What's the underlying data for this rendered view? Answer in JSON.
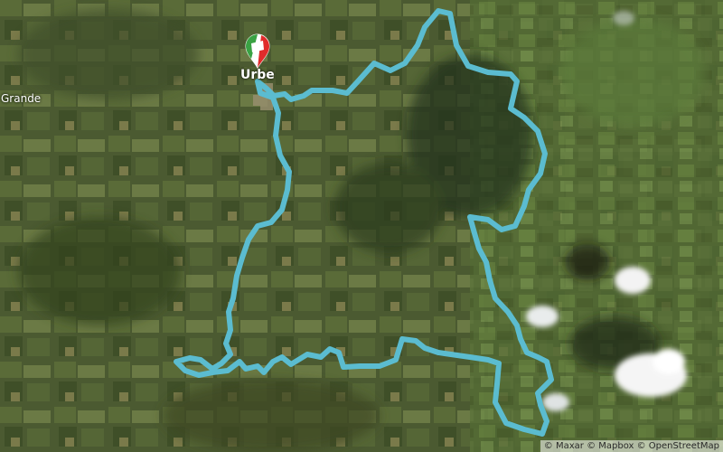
{
  "map": {
    "basemap": "satellite",
    "place_labels": {
      "town": "Urbe",
      "left_edge": "Grande"
    },
    "route": {
      "color": "#5bbcd0",
      "marker_colors": [
        "#3aa244",
        "#ffffff",
        "#e02b2b"
      ]
    },
    "clouds": [
      "white patches on right side of map"
    ],
    "attribution": {
      "maxar": "© Maxar",
      "mapbox": "© Mapbox",
      "osm": "© OpenStreetMap"
    }
  }
}
